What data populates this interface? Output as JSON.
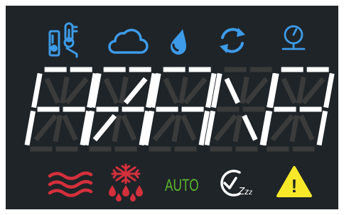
{
  "display": {
    "background_color": "#1f2428",
    "segment_on_color": "#ffffff",
    "segment_off_color": "#3a3b3a",
    "characters": [
      {
        "on": [
          "a1",
          "a2",
          "f",
          "b",
          "g1",
          "g2",
          "e",
          "c"
        ]
      },
      {
        "on": [
          "a1",
          "a2",
          "f",
          "b",
          "g1",
          "g2",
          "e",
          "c",
          "j",
          "k"
        ]
      },
      {
        "on": [
          "a1",
          "a2",
          "f",
          "b",
          "g1",
          "g2",
          "e",
          "c"
        ]
      },
      {
        "on": [
          "f",
          "b",
          "e",
          "c",
          "h",
          "m"
        ]
      },
      {
        "on": [
          "a1",
          "a2",
          "f",
          "b",
          "g1",
          "g2",
          "e",
          "c"
        ]
      }
    ]
  },
  "status_icons": [
    {
      "name": "thermostat-icon",
      "color": "#3d9be9"
    },
    {
      "name": "cloud-icon",
      "color": "#3d9be9"
    },
    {
      "name": "water-drop-icon",
      "color": "#3d9be9"
    },
    {
      "name": "sync-icon",
      "color": "#3d9be9"
    },
    {
      "name": "pressure-gauge-icon",
      "color": "#3d9be9"
    }
  ],
  "mode_icons": [
    {
      "name": "heating-waves-icon",
      "color": "#d4303c"
    },
    {
      "name": "defrost-icon",
      "color": "#d4303c"
    },
    {
      "name": "auto-mode-label",
      "label": "AUTO",
      "color": "#5ab52e"
    },
    {
      "name": "sleep-timer-icon",
      "label": "Zzz",
      "color": "#ffffff"
    },
    {
      "name": "warning-icon",
      "label": "!",
      "color": "#f7e82a"
    }
  ]
}
